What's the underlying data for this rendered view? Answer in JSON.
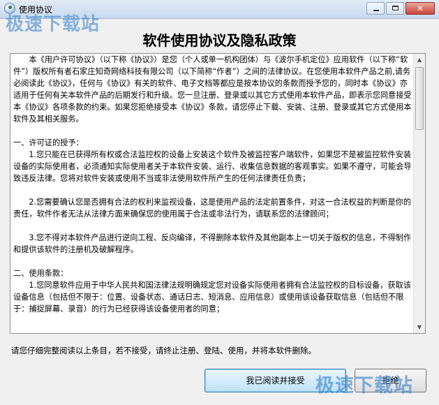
{
  "window": {
    "title": "使用协议",
    "watermark": "极速下载站",
    "close_glyph": "✕"
  },
  "dialog": {
    "heading": "软件使用协议及隐私政策",
    "paragraphs": [
      "　　本《用户许可协议》（以下称《协议》）是您（个人或单一机构团体）与《波尔手机定位》应用软件（以下称“软件”）版权所有者石家庄知奇网络科技有限公司（以下简称“作者”）之间的法律协议。在您使用本软件产品之前,请务必阅读此《协议》，任何与《协议》有关的软件、电子文档等都应是按本协议的条款而授予您的，同时本《协议》亦适用于任何有关本软件产品的后期发行和升级。您一旦注册、登录或以其它方式使用本软件产品，即表示您同意接受本《协议》各项条款的约束。如果您拒绝接受本《协议》条款，请您停止下载、安装、注册、登录或其它方式使用本软件及其相关服务。",
      "一、许可证的授予：",
      "　　1.您只能在已获得所有权或合法监控权的设备上安装这个软件及被监控客户端软件，如果您不是被监控软件安装设备的实际使用者，必须通知实际使用者关于本软件安装、运行、收集信息数据的客观事实。如果不遵守，可能会导致违反法律。您将对软件安装或使用不当或非法使用软件所产生的任何法律责任负责；",
      "　　2.您需要确认您是否拥有合法的权利来监视设备，这是使用产品的法定前置条件，对这一合法权益的判断是你的责任，软件作者无法从法律方面来确保您的使用属于合法或非法行为，请联系您的法律顾问；",
      "　　3.您不得对本软件产品进行逆向工程、反向编译，不得删除本软件及其他副本上一切关于版权的信息，不得制作和提供该软件的注册机及破解程序。",
      "二、使用条款：",
      "　　1.您同意软件应用于中华人民共和国法律法规明确规定您对设备实际使用者拥有合法监控权的目标设备，获取该设备信息（包括但不限于：位置、设备状态、通话日志、短消息、应用信息）或使用该设备获取信息（包括但不限于：捕捉屏幕、录音）的行为已经获得该设备使用者的同意；"
    ],
    "notice": "请您仔细完整阅读以上条目，若不接受，请终止注册、登陆、使用，并将本软件删除。",
    "accept_label": "我已阅读并接受",
    "reject_label": "拒绝"
  }
}
